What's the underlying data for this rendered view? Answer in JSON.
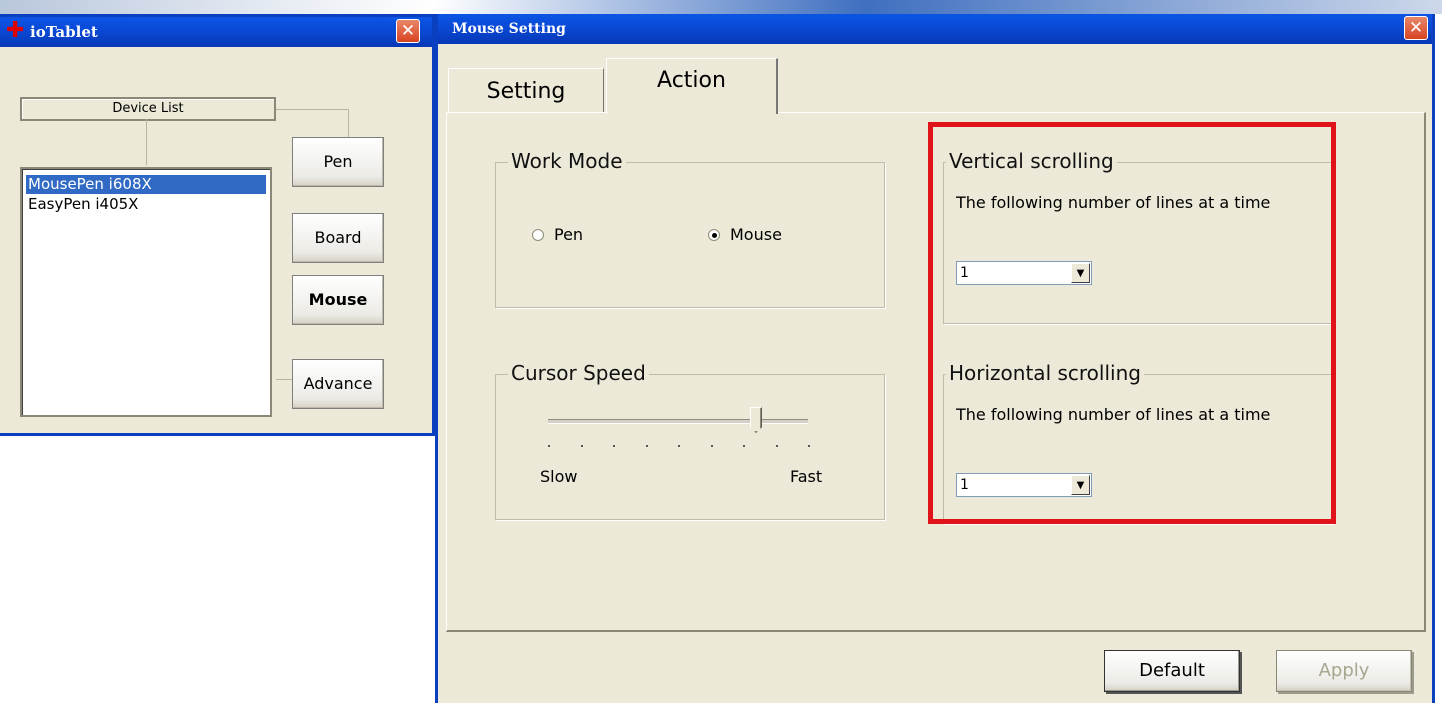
{
  "io_window": {
    "title": "ioTablet",
    "logo_icon": "tablet-logo-icon",
    "close_glyph": "✕",
    "device_list_label": "Device List",
    "devices": [
      {
        "name": "MousePen i608X",
        "selected": true
      },
      {
        "name": "EasyPen i405X",
        "selected": false
      }
    ],
    "nav_buttons": [
      {
        "label": "Pen",
        "active": false
      },
      {
        "label": "Board",
        "active": false
      },
      {
        "label": "Mouse",
        "active": true
      },
      {
        "label": "Advance",
        "active": false
      }
    ]
  },
  "mouse_window": {
    "title": "Mouse Setting",
    "close_glyph": "✕",
    "tabs": [
      {
        "label": "Setting",
        "active": false
      },
      {
        "label": "Action",
        "active": true
      }
    ],
    "work_mode": {
      "label": "Work Mode",
      "options": [
        {
          "label": "Pen",
          "checked": false
        },
        {
          "label": "Mouse",
          "checked": true
        }
      ]
    },
    "cursor_speed": {
      "label": "Cursor Speed",
      "slow_label": "Slow",
      "fast_label": "Fast",
      "level": 0.8,
      "tick_count": 9
    },
    "vertical_scrolling": {
      "label": "Vertical scrolling",
      "description": "The following number of lines at a time",
      "value": "1",
      "arrow_glyph": "▼"
    },
    "horizontal_scrolling": {
      "label": "Horizontal scrolling",
      "description": "The following number of lines at a time",
      "value": "1",
      "arrow_glyph": "▼"
    },
    "buttons": {
      "default_label": "Default",
      "apply_label": "Apply",
      "apply_enabled": false
    }
  },
  "colors": {
    "window_bg": "#ece9d8",
    "titlebar_blue": "#0a49d6",
    "selection_blue": "#316ac5",
    "highlight_red": "#e0131a"
  }
}
